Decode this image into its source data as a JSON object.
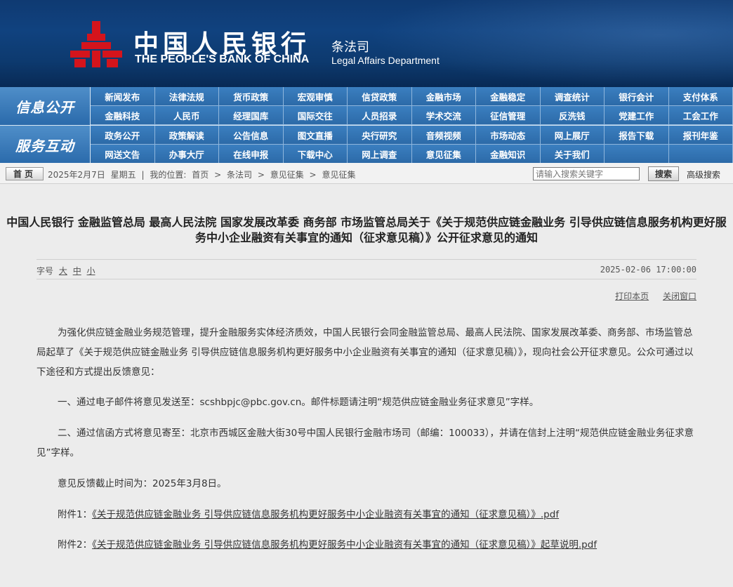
{
  "header": {
    "bank_name_cn": "中国人民银行",
    "bank_name_en": "THE PEOPLE'S BANK OF CHINA",
    "dept_cn": "条法司",
    "dept_en": "Legal Affairs Department",
    "logo_color": "#d4141c"
  },
  "nav": {
    "group1_title": "信息公开",
    "group1_items": [
      "新闻发布",
      "法律法规",
      "货币政策",
      "宏观审慎",
      "信贷政策",
      "金融市场",
      "金融稳定",
      "调查统计",
      "银行会计",
      "支付体系",
      "金融科技",
      "人民币",
      "经理国库",
      "国际交往",
      "人员招录",
      "学术交流",
      "征信管理",
      "反洗钱",
      "党建工作",
      "工会工作"
    ],
    "group2_title": "服务互动",
    "group2_items": [
      "政务公开",
      "政策解读",
      "公告信息",
      "图文直播",
      "央行研究",
      "音频视频",
      "市场动态",
      "网上展厅",
      "报告下载",
      "报刊年鉴",
      "网送文告",
      "办事大厅",
      "在线申报",
      "下载中心",
      "网上调查",
      "意见征集",
      "金融知识",
      "关于我们",
      "",
      ""
    ]
  },
  "breadcrumb": {
    "home_label": "首页",
    "date": "2025年2月7日",
    "weekday": "星期五",
    "sep": "|",
    "location_label": "我的位置:",
    "crumbs": [
      "首页",
      ">",
      "条法司",
      ">",
      "意见征集",
      ">",
      "意见征集"
    ],
    "search_placeholder": "请输入搜索关键字",
    "search_button": "搜索",
    "advanced_search": "高级搜索"
  },
  "article": {
    "title": "中国人民银行 金融监管总局 最高人民法院 国家发展改革委 商务部 市场监管总局关于《关于规范供应链金融业务 引导供应链信息服务机构更好服务中小企业融资有关事宜的通知（征求意见稿）》公开征求意见的通知",
    "font_size_label": "字号",
    "font_sizes": [
      "大",
      "中",
      "小"
    ],
    "date": "2025-02-06 17:00:00",
    "print_label": "打印本页",
    "close_label": "关闭窗口",
    "para1": "为强化供应链金融业务规范管理，提升金融服务实体经济质效，中国人民银行会同金融监管总局、最高人民法院、国家发展改革委、商务部、市场监管总局起草了《关于规范供应链金融业务 引导供应链信息服务机构更好服务中小企业融资有关事宜的通知（征求意见稿）》，现向社会公开征求意见。公众可通过以下途径和方式提出反馈意见：",
    "para2": "一、通过电子邮件将意见发送至：scshbpjc@pbc.gov.cn。邮件标题请注明“规范供应链金融业务征求意见”字样。",
    "para3": "二、通过信函方式将意见寄至：北京市西城区金融大街30号中国人民银行金融市场司（邮编：100033），并请在信封上注明“规范供应链金融业务征求意见”字样。",
    "para4": "意见反馈截止时间为：2025年3月8日。",
    "attach1_label": "附件1：",
    "attach1_link": "《关于规范供应链金融业务 引导供应链信息服务机构更好服务中小企业融资有关事宜的通知（征求意见稿）》.pdf",
    "attach2_label": "附件2：",
    "attach2_link": "《关于规范供应链金融业务 引导供应链信息服务机构更好服务中小企业融资有关事宜的通知（征求意见稿）》起草说明.pdf"
  }
}
